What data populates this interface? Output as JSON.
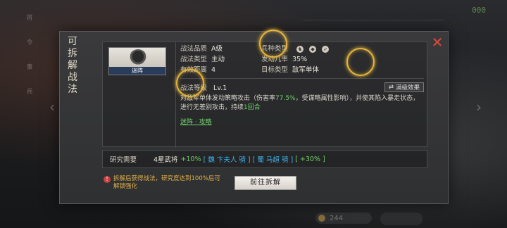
{
  "background": {
    "top_right_text": "000",
    "left_strip": [
      "将",
      "令",
      "事",
      "兵"
    ],
    "bottom_items": [
      "",
      ""
    ],
    "coin_value": "244"
  },
  "modal": {
    "side_title": "可拆解战法",
    "close_icon": "close-icon",
    "portrait_label": "迷阵",
    "stats": {
      "quality_key": "战法品质",
      "quality_val": "A级",
      "troop_key": "兵种类型",
      "type_key": "战法类型",
      "type_val": "主动",
      "rate_key": "发动几率",
      "rate_val": "35%",
      "range_key": "有效距离",
      "range_val": "4",
      "target_key": "目标类型",
      "target_val": "敌军单体"
    },
    "level_label": "战法等级",
    "level_val": "Lv.1",
    "full_effect_label": "满级效果",
    "desc_part1": "对敌军单体发动策略攻击（伤害率",
    "desc_rate": "77.5%",
    "desc_part2": "，受谋略属性影响），并使其陷入暴走状态，进行无差别攻击，持续",
    "desc_turns": "1回合",
    "link_text": "迷阵 · 攻略",
    "research_label": "研究需要",
    "research_req": "4星武将",
    "research_bonus": "+10%",
    "research_sel1": " [ 魏 卞夫人 骑 ] ",
    "research_sel2": "[ 蜀 马超 骑 ] ",
    "research_bonus2": "[ +30% ]",
    "warning": "拆解后获得战法，研究度达到100%后可解锁强化",
    "goto_button": "前往拆解"
  },
  "colors": {
    "accent_green": "#6fd36a",
    "accent_blue": "#3fb0e8",
    "close_red": "#e0483f",
    "warn_yellow": "#e2b04a",
    "ring_gold": "#e8b53a"
  }
}
